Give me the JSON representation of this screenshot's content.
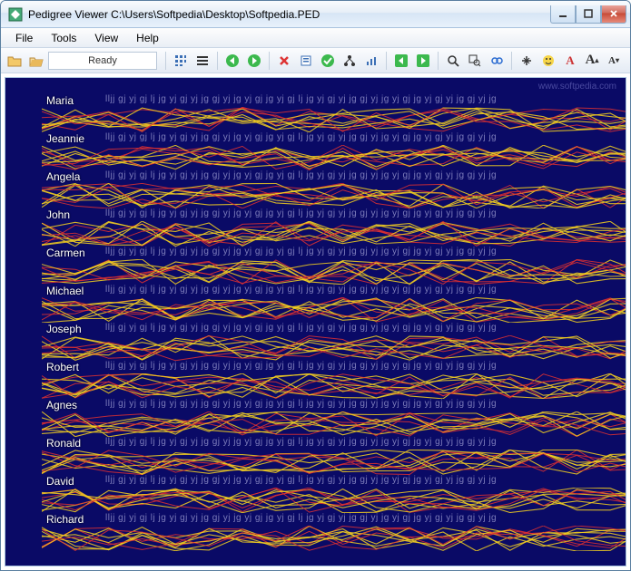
{
  "window": {
    "title": "Pedigree Viewer  C:\\Users\\Softpedia\\Desktop\\Softpedia.PED"
  },
  "menu": {
    "file": "File",
    "tools": "Tools",
    "view": "View",
    "help": "Help"
  },
  "toolbar": {
    "status": "Ready"
  },
  "watermark": "www.softpedia.com",
  "rows": [
    {
      "label": "Maria"
    },
    {
      "label": "Jeannie"
    },
    {
      "label": "Angela"
    },
    {
      "label": "John"
    },
    {
      "label": "Carmen"
    },
    {
      "label": "Michael"
    },
    {
      "label": "Joseph"
    },
    {
      "label": "Robert"
    },
    {
      "label": "Agnes"
    },
    {
      "label": "Ronald"
    },
    {
      "label": "David"
    },
    {
      "label": "Richard"
    }
  ]
}
